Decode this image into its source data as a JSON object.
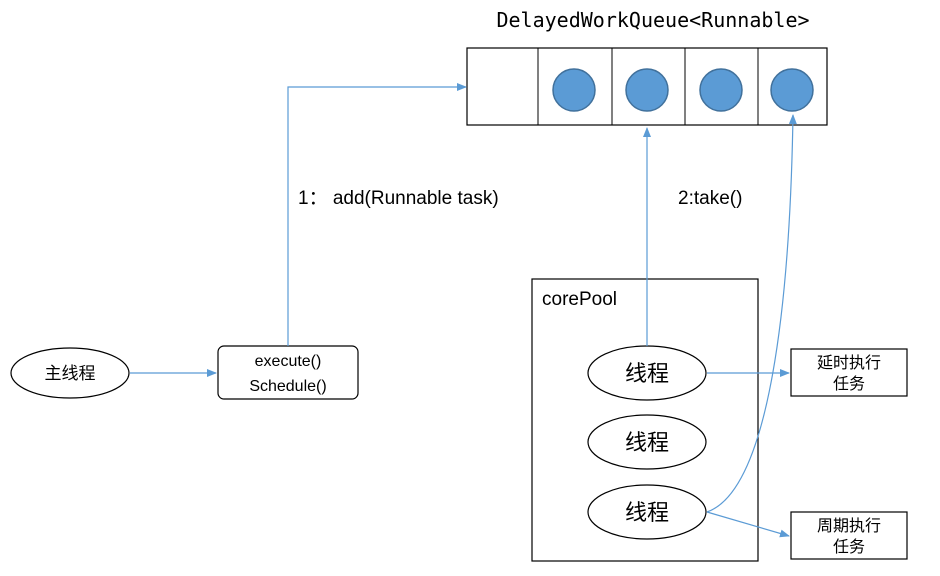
{
  "queue": {
    "title": "DelayedWorkQueue<Runnable>",
    "item_count": 4
  },
  "main_thread": {
    "label": "主线程"
  },
  "executor": {
    "line1": "execute()",
    "line2": "Schedule()"
  },
  "arrows": {
    "add_label": "1： add(Runnable task)",
    "take_label": "2:take()"
  },
  "core_pool": {
    "label": "corePool",
    "threads": [
      "线程",
      "线程",
      "线程"
    ]
  },
  "tasks": {
    "delayed": {
      "line1": "延时执行",
      "line2": "任务"
    },
    "periodic": {
      "line1": "周期执行",
      "line2": "任务"
    }
  },
  "colors": {
    "arrow": "#5b9bd5",
    "queue_item_fill": "#5b9bd5",
    "queue_item_stroke": "#41719c",
    "stroke": "#000000"
  }
}
